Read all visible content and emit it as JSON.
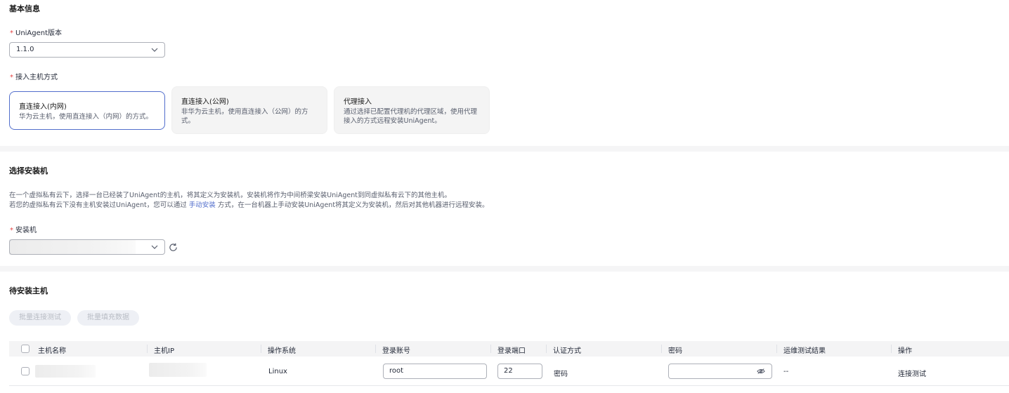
{
  "basic": {
    "title": "基本信息",
    "version_label": "UniAgent版本",
    "version_value": "1.1.0",
    "access_label": "接入主机方式",
    "access_options": [
      {
        "title": "直连接入(内网)",
        "desc": "华为云主机，使用直连接入（内网）的方式。",
        "selected": true
      },
      {
        "title": "直连接入(公网)",
        "desc": "非华为云主机，使用直连接入（公网）的方式。",
        "selected": false
      },
      {
        "title": "代理接入",
        "desc": "通过选择已配置代理机的代理区域，使用代理接入的方式远程安装UniAgent。",
        "selected": false
      }
    ]
  },
  "installer": {
    "title": "选择安装机",
    "desc_line1": "在一个虚拟私有云下，选择一台已经装了UniAgent的主机，将其定义为安装机，安装机将作为中间桥梁安装UniAgent到同虚拟私有云下的其他主机。",
    "desc_line2_prefix": "若您的虚拟私有云下没有主机安装过UniAgent，您可以通过",
    "desc_link": "手动安装",
    "desc_line2_suffix": "方式，在一台机器上手动安装UniAgent将其定义为安装机，然后对其他机器进行远程安装。",
    "field_label": "安装机",
    "refresh_icon": "refresh-icon"
  },
  "pending": {
    "title": "待安装主机",
    "batch_test_label": "批量连接测试",
    "batch_fill_label": "批量填充数据",
    "columns": [
      "主机名称",
      "主机IP",
      "操作系统",
      "登录账号",
      "登录端口",
      "认证方式",
      "密码",
      "运维测试结果",
      "操作"
    ],
    "rows": [
      {
        "os": "Linux",
        "account": "root",
        "port": "22",
        "auth": "密码",
        "result": "--",
        "action": "连接测试"
      }
    ]
  },
  "colors": {
    "accent": "#526ecc",
    "required": "#e54545"
  }
}
